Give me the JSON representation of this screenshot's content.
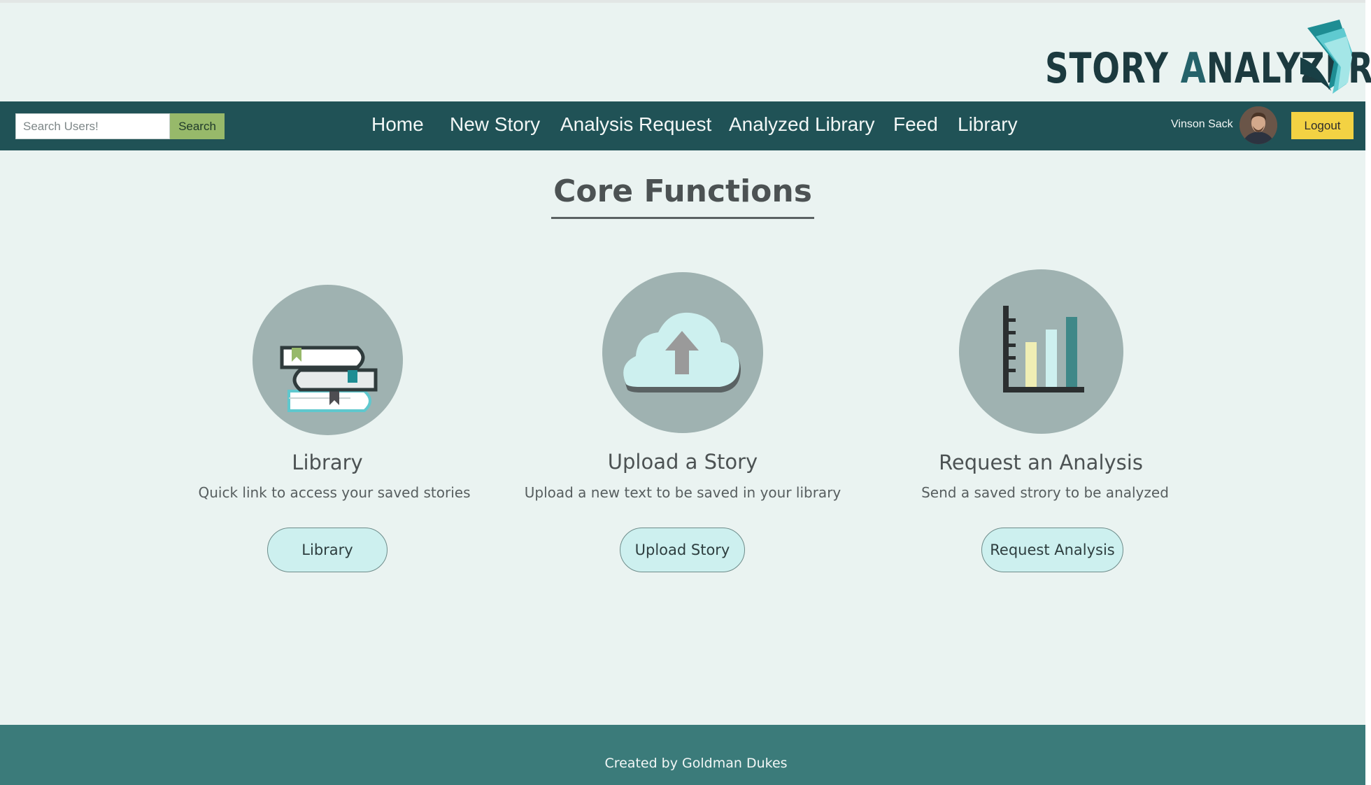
{
  "header": {
    "logo_word_1": "STORY",
    "logo_word_2_first": "A",
    "logo_word_2_rest": "NALYZER"
  },
  "search": {
    "placeholder": "Search Users!",
    "button_label": "Search"
  },
  "nav": {
    "items": [
      {
        "label": "Home"
      },
      {
        "label": "New Story"
      },
      {
        "label": "Analysis Request"
      },
      {
        "label": "Analyzed Library"
      },
      {
        "label": "Feed"
      },
      {
        "label": "Library"
      }
    ]
  },
  "user": {
    "name": "Vinson Sack",
    "logout_label": "Logout"
  },
  "main": {
    "title": "Core Functions",
    "cards": [
      {
        "icon": "books-icon",
        "title": "Library",
        "description": "Quick link to access your saved stories",
        "button_label": "Library"
      },
      {
        "icon": "cloud-upload-icon",
        "title": "Upload a Story",
        "description": "Upload a new text to be saved in your library",
        "button_label": "Upload Story"
      },
      {
        "icon": "bar-chart-icon",
        "title": "Request an Analysis",
        "description": "Send a saved strory to be analyzed",
        "button_label": "Request Analysis"
      }
    ]
  },
  "footer": {
    "text": "Created by Goldman Dukes"
  },
  "colors": {
    "page_background": "#eaf3f1",
    "navbar": "#205256",
    "footer": "#3b7b7a",
    "search_button": "#97b96a",
    "logout_button": "#f3d243",
    "card_button": "#cdf0ef",
    "icon_circle": "#9fb2b1"
  }
}
